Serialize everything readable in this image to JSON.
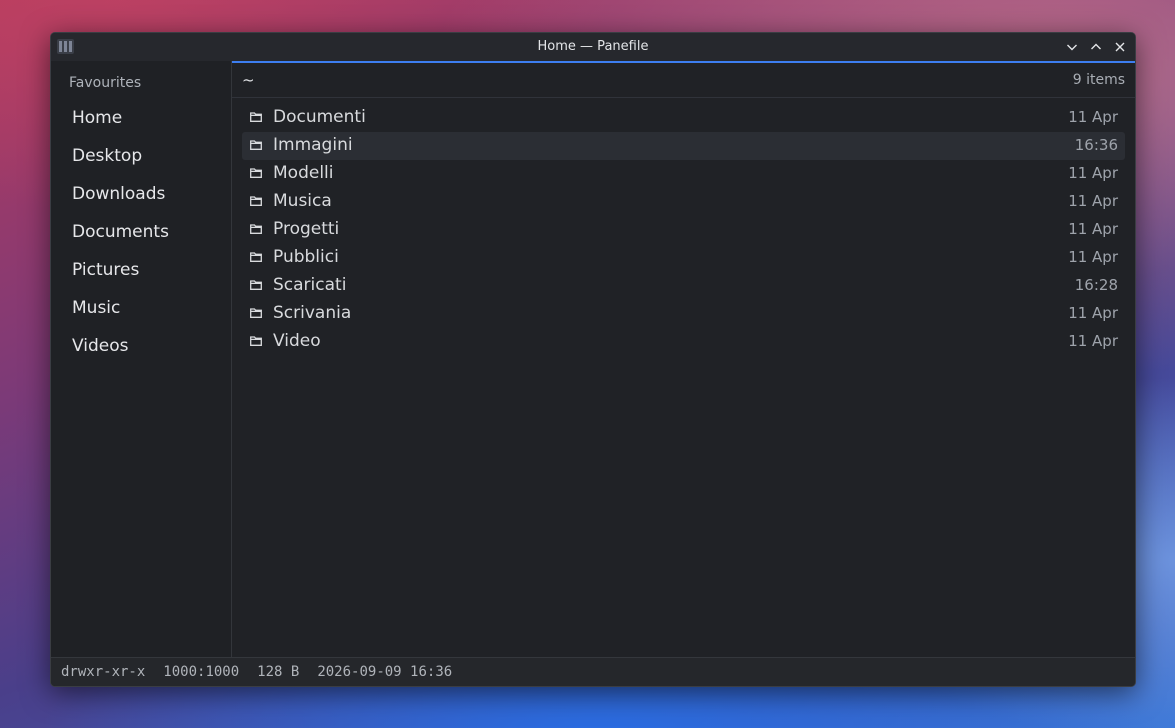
{
  "window": {
    "title": "Home — Panefile"
  },
  "sidebar": {
    "heading": "Favourites",
    "items": [
      {
        "label": "Home"
      },
      {
        "label": "Desktop"
      },
      {
        "label": "Downloads"
      },
      {
        "label": "Documents"
      },
      {
        "label": "Pictures"
      },
      {
        "label": "Music"
      },
      {
        "label": "Videos"
      }
    ]
  },
  "pathbar": {
    "path": "~",
    "count": "9 items"
  },
  "files": [
    {
      "name": "Documenti",
      "date": "11 Apr",
      "icon": "folder-icon"
    },
    {
      "name": "Immagini",
      "date": "16:36",
      "icon": "folder-icon",
      "selected": true
    },
    {
      "name": "Modelli",
      "date": "11 Apr",
      "icon": "folder-icon"
    },
    {
      "name": "Musica",
      "date": "11 Apr",
      "icon": "folder-icon"
    },
    {
      "name": "Progetti",
      "date": "11 Apr",
      "icon": "folder-icon"
    },
    {
      "name": "Pubblici",
      "date": "11 Apr",
      "icon": "folder-icon"
    },
    {
      "name": "Scaricati",
      "date": "16:28",
      "icon": "folder-icon"
    },
    {
      "name": "Scrivania",
      "date": "11 Apr",
      "icon": "folder-icon"
    },
    {
      "name": "Video",
      "date": "11 Apr",
      "icon": "folder-icon"
    }
  ],
  "status": {
    "permissions": "drwxr-xr-x",
    "owner": "1000:1000",
    "size": "128 B",
    "modified": "2026-09-09 16:36"
  },
  "colors": {
    "accent": "#3d7ef0",
    "window_bg": "#1f2125"
  }
}
